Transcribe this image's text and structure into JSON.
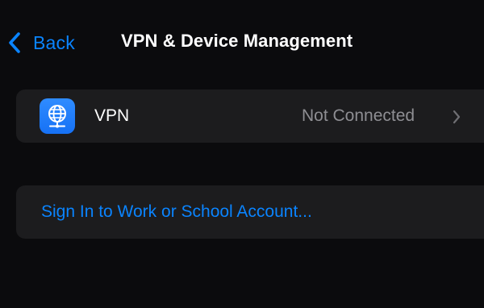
{
  "nav": {
    "back_label": "Back",
    "title": "VPN & Device Management"
  },
  "vpn_row": {
    "icon": "globe-network-icon",
    "label": "VPN",
    "status": "Not Connected",
    "chevron_icon": "chevron-right-icon"
  },
  "account": {
    "link_label": "Sign In to Work or School Account..."
  },
  "colors": {
    "background": "#0b0b0d",
    "cell_background": "#1c1c1e",
    "accent": "#0a84ff",
    "secondary_text": "#8e8e93",
    "vpn_icon": "#1a78ff"
  }
}
